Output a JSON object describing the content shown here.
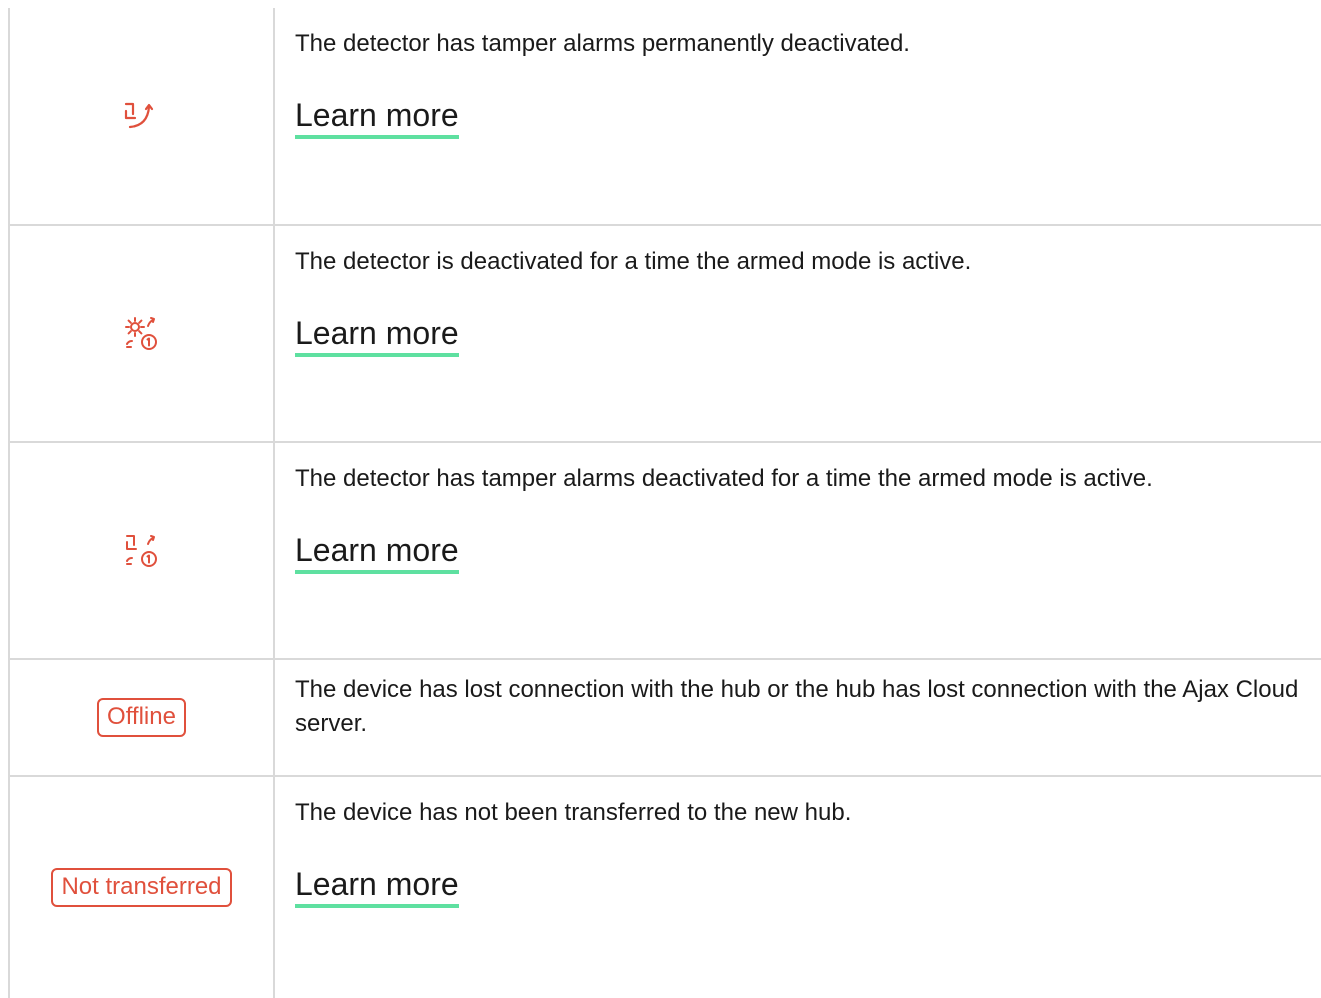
{
  "colors": {
    "accent_red": "#e0503c",
    "link_underline": "#5ee0a0",
    "border": "#d9d9d9",
    "text": "#1a1a1a"
  },
  "rows": [
    {
      "icon": "tamper-off-icon",
      "description": "The detector has tamper alarms permanently deactivated.",
      "link": "Learn more"
    },
    {
      "icon": "gear-once-icon",
      "description": "The detector is deactivated for a time the armed mode is active.",
      "link": "Learn more"
    },
    {
      "icon": "tamper-once-icon",
      "description": "The detector has tamper alarms deactivated for a time the armed mode is active.",
      "link": "Learn more"
    },
    {
      "badge": "Offline",
      "description": "The device has lost connection with the hub or the hub has lost connection with the Ajax Cloud server."
    },
    {
      "badge": "Not transferred",
      "description": "The device has not been transferred to the new hub.",
      "link": "Learn more"
    }
  ]
}
